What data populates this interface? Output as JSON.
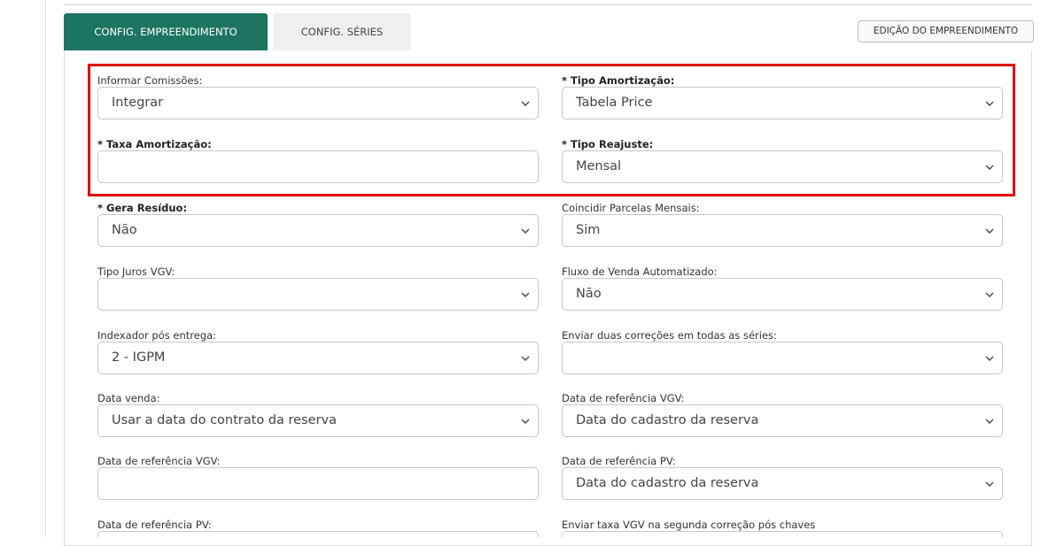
{
  "tabs": [
    {
      "label": "CONFIG. EMPREENDIMENTO",
      "active": true
    },
    {
      "label": "CONFIG. SÉRIES",
      "active": false
    }
  ],
  "edit_button": {
    "label": "EDIÇÃO DO EMPREENDIMENTO"
  },
  "colors": {
    "tab_active": "#1d7560",
    "highlight_border": "#e10000"
  },
  "fields": {
    "informar_comissoes": {
      "label": "Informar Comissões:",
      "value": "Integrar",
      "required": false,
      "type": "select"
    },
    "tipo_amortizacao": {
      "label": "* Tipo Amortização:",
      "value": "Tabela Price",
      "required": true,
      "type": "select"
    },
    "taxa_amortizacao": {
      "label": "* Taxa Amortização:",
      "value": "",
      "required": true,
      "type": "text"
    },
    "tipo_reajuste": {
      "label": "* Tipo Reajuste:",
      "value": "Mensal",
      "required": true,
      "type": "select"
    },
    "gera_residuo": {
      "label": "* Gera Resíduo:",
      "value": "Não",
      "required": true,
      "type": "select"
    },
    "coincidir_parcelas": {
      "label": "Coincidir Parcelas Mensais:",
      "value": "Sim",
      "required": false,
      "type": "select"
    },
    "tipo_juros_vgv": {
      "label": "Tipo Juros VGV:",
      "value": "",
      "required": false,
      "type": "select"
    },
    "fluxo_venda": {
      "label": "Fluxo de Venda Automatizado:",
      "value": "Não",
      "required": false,
      "type": "select"
    },
    "indexador_pos_entrega": {
      "label": "Indexador pós entrega:",
      "value": "2 - IGPM",
      "required": false,
      "type": "select"
    },
    "enviar_duas_correcoes": {
      "label": "Enviar duas correções em todas as séries:",
      "value": "",
      "required": false,
      "type": "select"
    },
    "data_venda": {
      "label": "Data venda:",
      "value": "Usar a data do contrato da reserva",
      "required": false,
      "type": "select"
    },
    "data_ref_vgv_right": {
      "label": "Data de referência VGV:",
      "value": "Data do cadastro da reserva",
      "required": false,
      "type": "select"
    },
    "data_ref_vgv_left": {
      "label": "Data de referência VGV:",
      "value": "",
      "required": false,
      "type": "text"
    },
    "data_ref_pv_right": {
      "label": "Data de referência PV:",
      "value": "Data do cadastro da reserva",
      "required": false,
      "type": "select"
    },
    "data_ref_pv_left": {
      "label": "Data de referência PV:",
      "value": "",
      "required": false,
      "type": "text"
    },
    "enviar_taxa_vgv": {
      "label": "Enviar taxa VGV na segunda correção pós chaves",
      "value": "",
      "required": false,
      "type": "select"
    }
  },
  "icons": {
    "select_arrow": "chevron-down-icon"
  }
}
